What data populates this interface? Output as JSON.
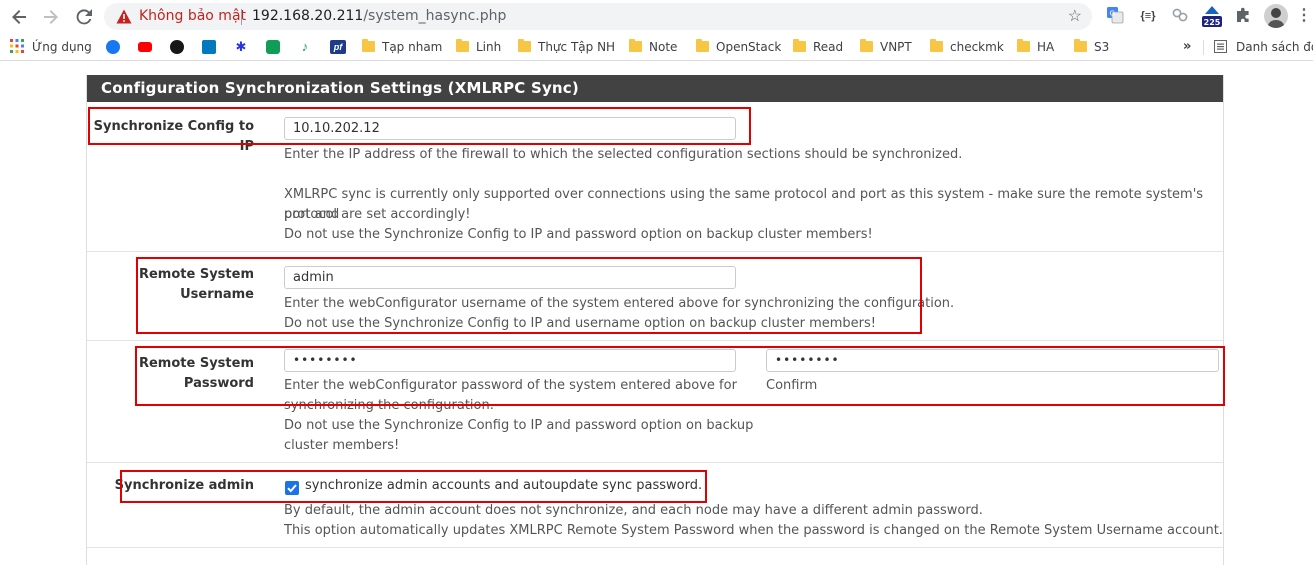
{
  "browser": {
    "security_warning": "Không bảo mật",
    "url_host": "192.168.20.211",
    "url_path": "/system_hasync.php",
    "extension_badge": "225",
    "bookmarks": {
      "apps_label": "Ứng dụng",
      "folders": [
        "Tạp nham",
        "Linh",
        "Thực Tập NH",
        "Note",
        "OpenStack",
        "Read",
        "VNPT",
        "checkmk",
        "HA",
        "S3"
      ],
      "overflow": "»",
      "reading_list": "Danh sách đọc"
    }
  },
  "panel": {
    "title": "Configuration Synchronization Settings (XMLRPC Sync)"
  },
  "sync_ip": {
    "label": "Synchronize Config to IP",
    "value": "10.10.202.12",
    "help1": "Enter the IP address of the firewall to which the selected configuration sections should be synchronized.",
    "help2": "XMLRPC sync is currently only supported over connections using the same protocol and port as this system - make sure the remote system's port and",
    "help3": "protocol are set accordingly!",
    "help4": "Do not use the Synchronize Config to IP and password option on backup cluster members!"
  },
  "remote_username": {
    "label_line1": "Remote System",
    "label_line2": "Username",
    "value": "admin",
    "help1": "Enter the webConfigurator username of the system entered above for synchronizing the configuration.",
    "help2": "Do not use the Synchronize Config to IP and username option on backup cluster members!"
  },
  "remote_password": {
    "label_line1": "Remote System",
    "label_line2": "Password",
    "value": "••••••••",
    "confirm_value": "••••••••",
    "help1": "Enter the webConfigurator password of the system entered above for",
    "help2": "synchronizing the configuration.",
    "help3": "Do not use the Synchronize Config to IP and password option on backup",
    "help4": "cluster members!",
    "confirm_label": "Confirm"
  },
  "sync_admin": {
    "label": "Synchronize admin",
    "checked": true,
    "checkbox_text": "synchronize admin accounts and autoupdate sync password.",
    "help1": "By default, the admin account does not synchronize, and each node may have a different admin password.",
    "help2": "This option automatically updates XMLRPC Remote System Password when the password is changed on the Remote System Username account."
  },
  "colors": {
    "heading_bg": "#424242",
    "highlight_box": "#e00000",
    "checkbox_accent": "#1a73e8",
    "warning_red": "#c5221f"
  }
}
